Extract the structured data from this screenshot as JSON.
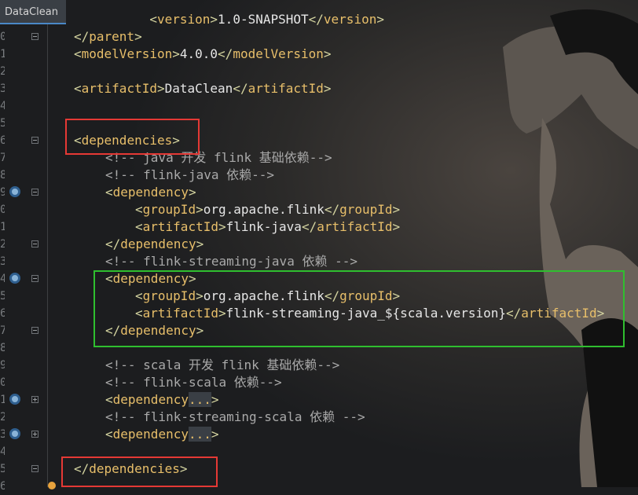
{
  "tab": {
    "title": "DataClean"
  },
  "gutter": {
    "line_numbers": [
      "9",
      "0",
      "1",
      "2",
      "3",
      "4",
      "5",
      "6",
      "7",
      "8",
      "9",
      "0",
      "1",
      "2",
      "3",
      "4",
      "5",
      "6",
      "7",
      "8",
      "9",
      "0",
      "1",
      "2",
      "3",
      "4",
      "5",
      "6"
    ]
  },
  "code": {
    "l0": {
      "open": "<",
      "tag": "version",
      "close": ">",
      "text": "1.0-SNAPSHOT",
      "endopen": "</",
      "endtag": "version",
      "endclose": ">"
    },
    "l1": {
      "open": "</",
      "tag": "parent",
      "close": ">"
    },
    "l2": {
      "open": "<",
      "tag": "modelVersion",
      "close": ">",
      "text": "4.0.0",
      "endopen": "</",
      "endtag": "modelVersion",
      "endclose": ">"
    },
    "l4": {
      "open": "<",
      "tag": "artifactId",
      "close": ">",
      "text": "DataClean",
      "endopen": "</",
      "endtag": "artifactId",
      "endclose": ">"
    },
    "l7": {
      "open": "<",
      "tag": "dependencies",
      "close": ">"
    },
    "l8": {
      "comment": "<!-- java 开发 flink 基础依赖-->"
    },
    "l9": {
      "comment": "<!-- flink-java 依赖-->"
    },
    "l10": {
      "open": "<",
      "tag": "dependency",
      "close": ">"
    },
    "l11": {
      "open": "<",
      "tag": "groupId",
      "close": ">",
      "text": "org.apache.flink",
      "endopen": "</",
      "endtag": "groupId",
      "endclose": ">"
    },
    "l12": {
      "open": "<",
      "tag": "artifactId",
      "close": ">",
      "text": "flink-java",
      "endopen": "</",
      "endtag": "artifactId",
      "endclose": ">"
    },
    "l13": {
      "open": "</",
      "tag": "dependency",
      "close": ">"
    },
    "l14": {
      "comment": "<!-- flink-streaming-java 依赖 -->"
    },
    "l15": {
      "open": "<",
      "tag": "dependency",
      "close": ">"
    },
    "l16": {
      "open": "<",
      "tag": "groupId",
      "close": ">",
      "text": "org.apache.flink",
      "endopen": "</",
      "endtag": "groupId",
      "endclose": ">"
    },
    "l17": {
      "open": "<",
      "tag": "artifactId",
      "close": ">",
      "text": "flink-streaming-java_${scala.version}",
      "endopen": "</",
      "endtag": "artifactId",
      "endclose": ">"
    },
    "l18": {
      "open": "</",
      "tag": "dependency",
      "close": ">"
    },
    "l20": {
      "comment": "<!-- scala 开发 flink 基础依赖-->"
    },
    "l21": {
      "comment": "<!-- flink-scala 依赖-->"
    },
    "l22": {
      "open": "<",
      "tag": "dependency",
      "fold": "...",
      "close": ">"
    },
    "l23": {
      "comment": "<!-- flink-streaming-scala 依赖 -->"
    },
    "l24": {
      "open": "<",
      "tag": "dependency",
      "fold": "...",
      "close": ">"
    },
    "l26": {
      "open": "</",
      "tag": "dependencies",
      "close": ">"
    }
  },
  "colors": {
    "tag": "#e8bf6a",
    "comment": "#a9a9a9",
    "text": "#e6e6e6",
    "highlight_red": "#e53935",
    "highlight_green": "#2fbf2f"
  }
}
